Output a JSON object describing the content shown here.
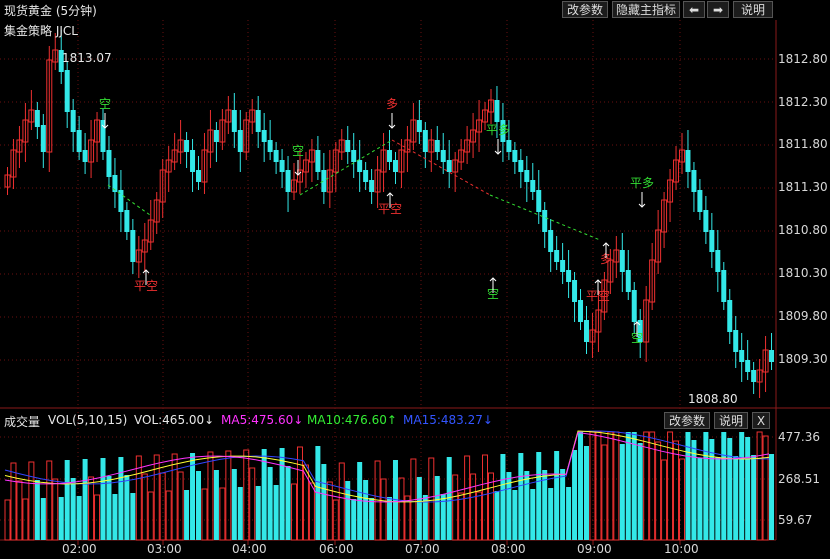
{
  "window": {
    "title": "现货黄金 (5分钟)",
    "buttons": {
      "modify_params": "改参数",
      "hide_indicator": "隐藏主指标",
      "left_arrow": "⬅",
      "right_arrow": "➡",
      "help": "说明"
    }
  },
  "main_chart": {
    "strategy_label": "集金策略 JJCL",
    "high_label": "1813.07",
    "low_label": "1808.80",
    "y_axis_labels": [
      "1812.80",
      "1812.30",
      "1811.80",
      "1811.30",
      "1810.80",
      "1810.30",
      "1809.80",
      "1809.30"
    ],
    "signals": [
      {
        "text": "空",
        "color": "#33dd33"
      },
      {
        "text": "平空",
        "color": "#ee3030"
      },
      {
        "text": "空",
        "color": "#33dd33"
      },
      {
        "text": "平空",
        "color": "#ee3030"
      },
      {
        "text": "多",
        "color": "#ee3030"
      },
      {
        "text": "平多",
        "color": "#33dd33"
      },
      {
        "text": "空",
        "color": "#33dd33"
      },
      {
        "text": "平空",
        "color": "#ee3030"
      },
      {
        "text": "多",
        "color": "#ee3030"
      },
      {
        "text": "平多",
        "color": "#33dd33"
      },
      {
        "text": "空",
        "color": "#33dd33"
      }
    ]
  },
  "volume_panel": {
    "title": "成交量",
    "params": "VOL(5,10,15)",
    "vol": "VOL:465.00↓",
    "ma5": "MA5:475.60↓",
    "ma10": "MA10:476.60↑",
    "ma15": "MA15:483.27↓",
    "buttons": {
      "modify_params": "改参数",
      "help": "说明",
      "close": "X"
    },
    "y_axis_labels": [
      "477.36",
      "268.51",
      "59.67"
    ]
  },
  "x_axis_labels": [
    "02:00",
    "03:00",
    "04:00",
    "06:00",
    "07:00",
    "08:00",
    "09:00",
    "10:00"
  ],
  "colors": {
    "up": "#ee3030",
    "down": "#33e8e8",
    "ma5": "#ff33ff",
    "ma10": "#ffff33",
    "ma15": "#3344ff",
    "signal_long": "#ee3030",
    "signal_short": "#33dd33"
  }
}
